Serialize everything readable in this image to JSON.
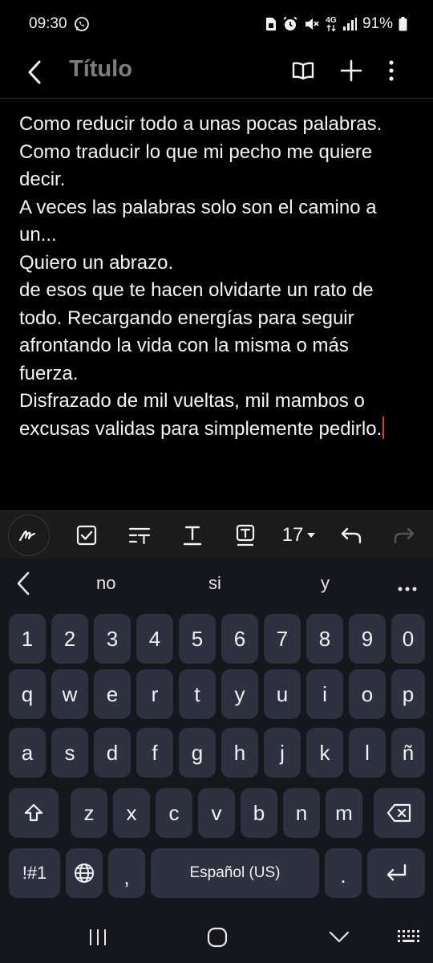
{
  "status_bar": {
    "time": "09:30",
    "network": "4G",
    "battery": "91%",
    "icons": [
      "whatsapp-icon",
      "sim-icon",
      "alarm-icon",
      "mute-icon",
      "data-arrows-icon",
      "signal-icon",
      "battery-icon"
    ]
  },
  "app_bar": {
    "title": "Título",
    "icons": [
      "back-arrow-icon",
      "book-icon",
      "plus-icon",
      "more-vert-icon"
    ]
  },
  "note": {
    "lines": [
      "Como reducir todo a unas pocas palabras.",
      "Como traducir lo que mi pecho me quiere",
      "decir.",
      "A veces las palabras solo son el camino a",
      "un...",
      "Quiero un abrazo.",
      "de esos que te hacen olvidarte un rato de",
      "todo. Recargando energías para seguir",
      "afrontando la vida con la misma o más",
      "fuerza.",
      "Disfrazado de mil vueltas, mil mambos o",
      "excusas validas para simplemente pedirlo."
    ],
    "cursor_color": "#e23c2c"
  },
  "format_bar": {
    "font_size": "17",
    "icons": [
      "handwriting-icon",
      "checkbox-icon",
      "text-style-icon",
      "underline-text-icon",
      "text-box-icon",
      "undo-icon",
      "redo-icon"
    ]
  },
  "keyboard": {
    "suggestions": [
      "no",
      "si",
      "y"
    ],
    "number_row": [
      "1",
      "2",
      "3",
      "4",
      "5",
      "6",
      "7",
      "8",
      "9",
      "0"
    ],
    "row1": [
      "q",
      "w",
      "e",
      "r",
      "t",
      "y",
      "u",
      "i",
      "o",
      "p"
    ],
    "row2": [
      "a",
      "s",
      "d",
      "f",
      "g",
      "h",
      "j",
      "k",
      "l",
      "ñ"
    ],
    "row3": [
      "z",
      "x",
      "c",
      "v",
      "b",
      "n",
      "m"
    ],
    "symbols_label": "!#1",
    "comma": ",",
    "space_label": "Español (US)",
    "period": ".",
    "key_color": "#2e3140",
    "background_color": "#15171c"
  },
  "nav_bar": {
    "icons": [
      "recents-icon",
      "home-icon",
      "back-chevron-icon",
      "keyboard-hide-icon"
    ]
  }
}
